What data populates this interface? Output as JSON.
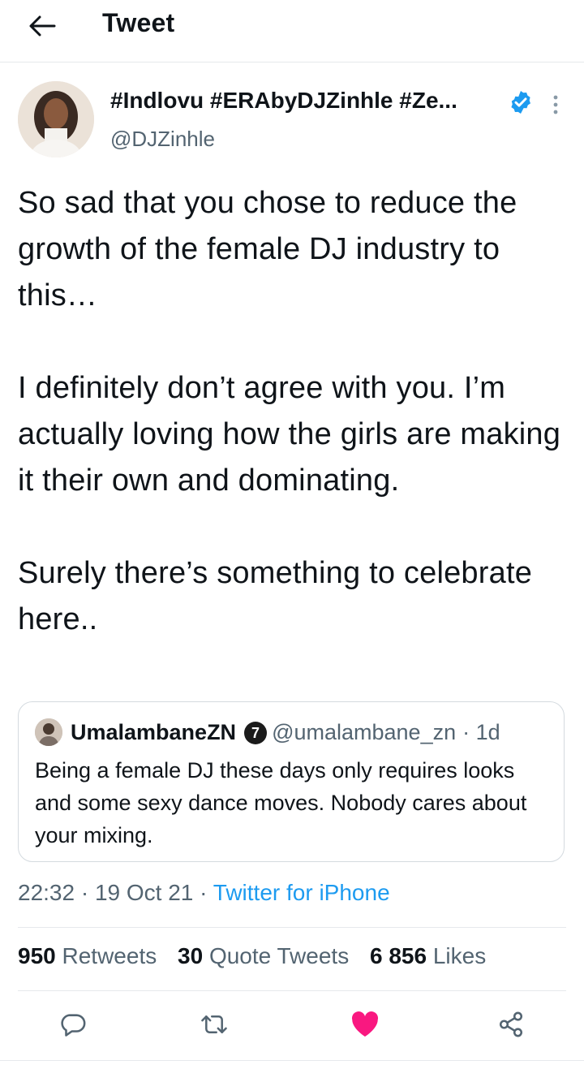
{
  "header": {
    "title": "Tweet",
    "back_icon": "arrow-left-icon"
  },
  "author": {
    "display_name": "#Indlovu #ERAbyDJZinhle #Ze...",
    "handle": "@DJZinhle",
    "verified": true,
    "verified_color": "#1d9bf0"
  },
  "tweet": {
    "paragraphs": [
      "So sad that you chose to reduce the growth of the female DJ industry to this…",
      "I definitely don’t agree with you. I’m actually loving how the girls are making it their own and dominating.",
      "Surely there’s something to celebrate here.."
    ]
  },
  "quoted": {
    "name": "UmalambaneZN",
    "badge": "7",
    "handle": "@umalambane_zn",
    "time": "· 1d",
    "text": "Being a female DJ these days only requires looks and some sexy dance moves. Nobody cares about your mixing."
  },
  "meta": {
    "time": "22:32",
    "date": "· 19 Oct 21 ·",
    "source": "Twitter for iPhone",
    "link_color": "#1d9bf0"
  },
  "stats": {
    "retweets_count": "950",
    "retweets_label": "Retweets",
    "quotes_count": "30",
    "quotes_label": "Quote Tweets",
    "likes_count": "6 856",
    "likes_label": "Likes"
  },
  "actions": {
    "icons": [
      "reply-icon",
      "retweet-icon",
      "like-icon",
      "share-icon"
    ],
    "liked": true,
    "like_color": "#f91880",
    "icon_color": "#536471"
  }
}
